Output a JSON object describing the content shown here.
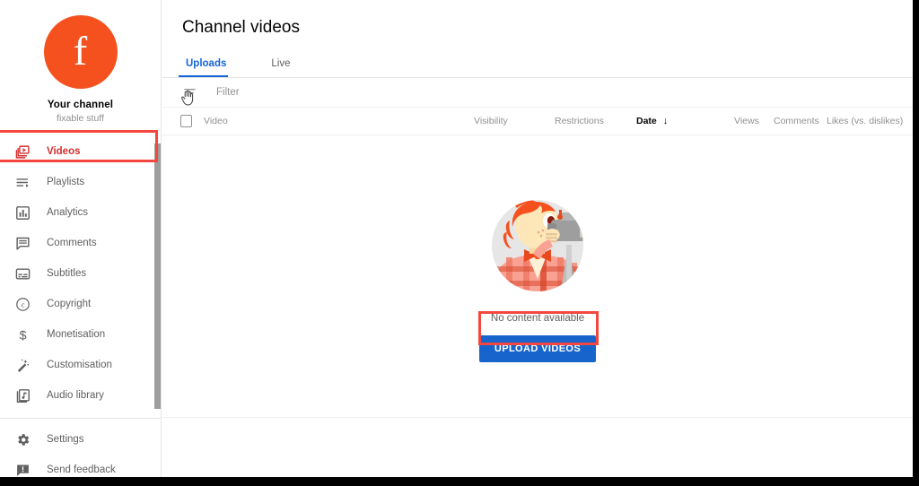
{
  "sidebar": {
    "channel": {
      "avatar_letter": "f",
      "avatar_color": "#f4511e",
      "name": "Your channel",
      "handle": "fixable stuff"
    },
    "items": [
      {
        "label": "Videos",
        "icon": "videos-icon",
        "active": true
      },
      {
        "label": "Playlists",
        "icon": "playlists-icon",
        "active": false
      },
      {
        "label": "Analytics",
        "icon": "analytics-icon",
        "active": false
      },
      {
        "label": "Comments",
        "icon": "comments-icon",
        "active": false
      },
      {
        "label": "Subtitles",
        "icon": "subtitles-icon",
        "active": false
      },
      {
        "label": "Copyright",
        "icon": "copyright-icon",
        "active": false
      },
      {
        "label": "Monetisation",
        "icon": "dollar-icon",
        "active": false
      },
      {
        "label": "Customisation",
        "icon": "magic-wand-icon",
        "active": false
      },
      {
        "label": "Audio library",
        "icon": "audio-library-icon",
        "active": false
      }
    ],
    "footer_items": [
      {
        "label": "Settings",
        "icon": "gear-icon"
      },
      {
        "label": "Send feedback",
        "icon": "feedback-icon"
      }
    ],
    "active_color": "#d32f2f"
  },
  "main": {
    "title": "Channel videos",
    "tabs": [
      {
        "label": "Uploads",
        "active": true
      },
      {
        "label": "Live",
        "active": false
      }
    ],
    "tab_active_color": "#1565d8",
    "filter": {
      "icon": "filter-icon",
      "placeholder": "Filter"
    },
    "table": {
      "headers": {
        "video": "Video",
        "visibility": "Visibility",
        "restrictions": "Restrictions",
        "date": "Date",
        "date_sort_arrow": "↓",
        "views": "Views",
        "comments": "Comments",
        "likes": "Likes (vs. dislikes)"
      },
      "rows": []
    },
    "empty_state": {
      "illustration": "videographer-illustration",
      "message": "No content available",
      "button_label": "UPLOAD VIDEOS",
      "button_color": "#1765cc"
    }
  },
  "annotations": {
    "color": "#f4473f",
    "highlights": [
      "sidebar-item-videos",
      "upload-videos-button"
    ]
  }
}
